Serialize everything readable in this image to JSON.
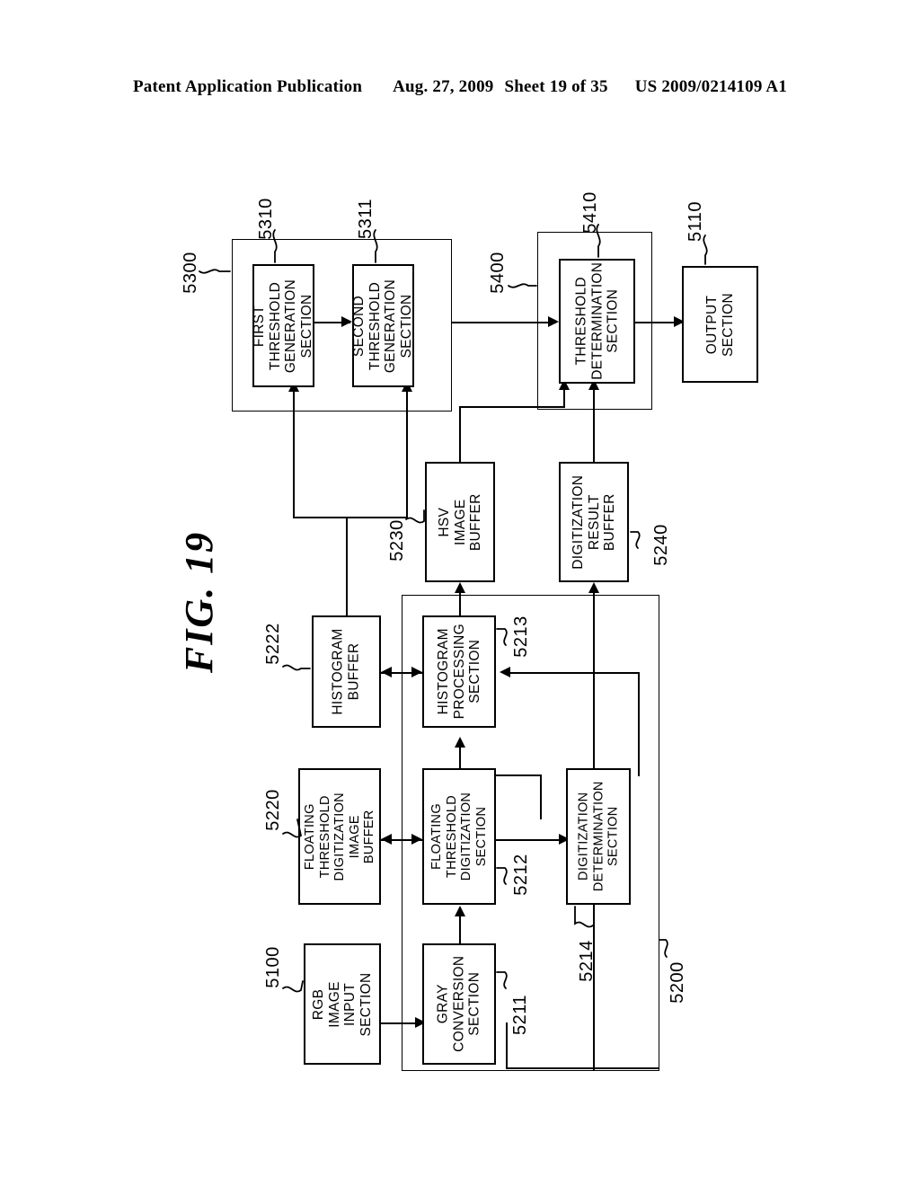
{
  "header": {
    "publication": "Patent Application Publication",
    "date": "Aug. 27, 2009",
    "sheet": "Sheet 19 of 35",
    "number": "US 2009/0214109 A1"
  },
  "figure": {
    "title": "FIG. 19",
    "orientation": "rotated-90-ccw"
  },
  "blocks": {
    "rgb_image_input": {
      "label": "RGB IMAGE\nINPUT\nSECTION",
      "ref": "5100"
    },
    "gray_conversion": {
      "label": "GRAY\nCONVERSION\nSECTION",
      "ref": "5211"
    },
    "floating_threshold_digitization_image_buffer": {
      "label": "FLOATING\nTHRESHOLD\nDIGITIZATION\nIMAGE BUFFER",
      "ref": "5220"
    },
    "floating_threshold_digitization_section": {
      "label": "FLOATING\nTHRESHOLD\nDIGITIZATION\nSECTION",
      "ref": "5212"
    },
    "digitization_determination": {
      "label": "DIGITIZATION\nDETERMINATION\nSECTION",
      "ref": "5214"
    },
    "histogram_buffer": {
      "label": "HISTOGRAM\nBUFFER",
      "ref": "5222"
    },
    "histogram_processing": {
      "label": "HISTOGRAM\nPROCESSING\nSECTION",
      "ref": "5213"
    },
    "hsv_image_buffer": {
      "label": "HSV IMAGE\nBUFFER",
      "ref": "5230"
    },
    "digitization_result_buffer": {
      "label": "DIGITIZATION\nRESULT\nBUFFER",
      "ref": "5240"
    },
    "first_threshold_generation": {
      "label": "FIRST\nTHRESHOLD\nGENERATION\nSECTION",
      "ref": "5310"
    },
    "second_threshold_generation": {
      "label": "SECOND\nTHRESHOLD\nGENERATION\nSECTION",
      "ref": "5311"
    },
    "threshold_determination": {
      "label": "THRESHOLD\nDETERMINATION\nSECTION",
      "ref": "5410"
    },
    "output_section": {
      "label": "OUTPUT\nSECTION",
      "ref": "5110"
    }
  },
  "groups": {
    "image_processing_unit": {
      "ref": "5200"
    },
    "threshold_generation_unit": {
      "ref": "5300"
    },
    "threshold_determination_unit": {
      "ref": "5400"
    }
  }
}
